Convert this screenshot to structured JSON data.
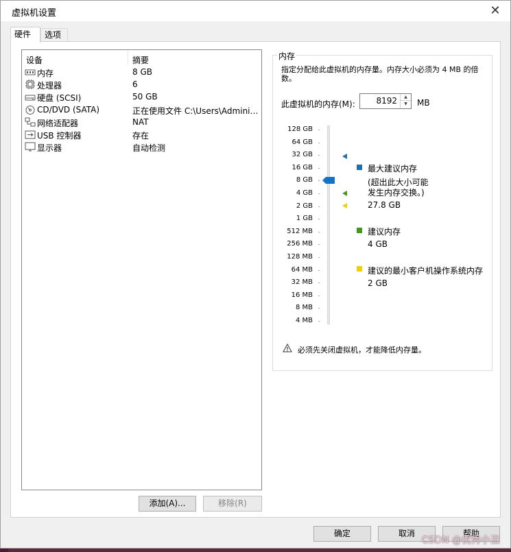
{
  "window": {
    "title": "虚拟机设置"
  },
  "tabs": [
    {
      "label": "硬件",
      "active": true
    },
    {
      "label": "选项",
      "active": false
    }
  ],
  "device_list": {
    "columns": {
      "device": "设备",
      "summary": "摘要"
    },
    "rows": [
      {
        "icon": "memory-icon",
        "name": "内存",
        "summary": "8 GB"
      },
      {
        "icon": "processor-icon",
        "name": "处理器",
        "summary": "6"
      },
      {
        "icon": "hard-disk-icon",
        "name": "硬盘 (SCSI)",
        "summary": "50 GB"
      },
      {
        "icon": "cd-dvd-icon",
        "name": "CD/DVD (SATA)",
        "summary": "正在使用文件 C:\\Users\\Adminis..."
      },
      {
        "icon": "network-adapter-icon",
        "name": "网络适配器",
        "summary": "NAT"
      },
      {
        "icon": "usb-controller-icon",
        "name": "USB 控制器",
        "summary": "存在"
      },
      {
        "icon": "display-icon",
        "name": "显示器",
        "summary": "自动检测"
      }
    ]
  },
  "list_buttons": {
    "add": "添加(A)...",
    "remove": "移除(R)"
  },
  "memory": {
    "group_title": "内存",
    "description": "指定分配给此虚拟机的内存量。内存大小必须为 4 MB 的倍数。",
    "label": "此虚拟机的内存(M):",
    "value": "8192",
    "unit": "MB",
    "slider_ticks": [
      "128 GB",
      "64 GB",
      "32 GB",
      "16 GB",
      "8 GB",
      "4 GB",
      "2 GB",
      "1 GB",
      "512 MB",
      "256 MB",
      "128 MB",
      "64 MB",
      "32 MB",
      "16 MB",
      "8 MB",
      "4 MB"
    ],
    "slider_value": "8 GB",
    "legend": {
      "max": {
        "label": "最大建议内存",
        "note": "(超出此大小可能\n发生内存交换。)",
        "value": "27.8 GB",
        "color": "#1f6fb5"
      },
      "recommended": {
        "label": "建议内存",
        "value": "4 GB",
        "color": "#3f9a1c"
      },
      "min_guest": {
        "label": "建议的最小客户机操作系统内存",
        "value": "2 GB",
        "color": "#f2d000"
      }
    },
    "warning": "必须先关闭虚拟机，才能降低内存量。"
  },
  "dialog_buttons": {
    "ok": "确定",
    "cancel": "取消",
    "help": "帮助"
  },
  "watermark": "CSDN @优秀小丑",
  "colors": {
    "accent": "#0078d7",
    "thumb": "#1473c8"
  }
}
